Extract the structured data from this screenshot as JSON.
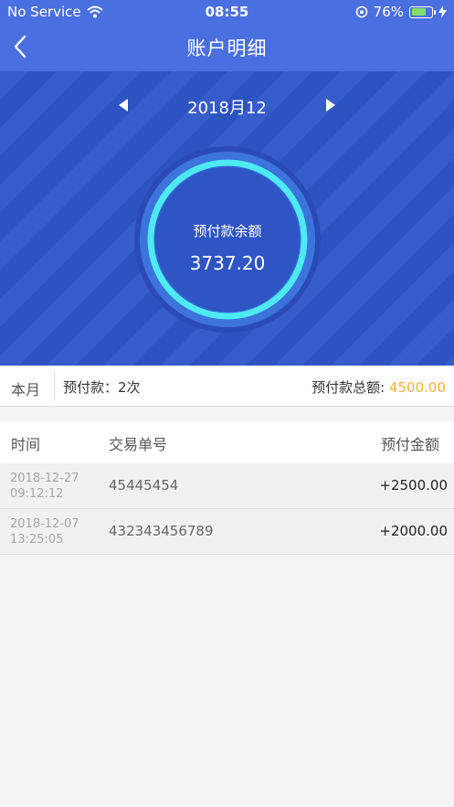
{
  "status_bar": {
    "carrier": "No Service",
    "time": "08:55",
    "battery_percent": "76%",
    "battery_level": 0.76
  },
  "nav": {
    "title": "账户明细",
    "back_icon": "chevron-left-icon"
  },
  "hero": {
    "month": "2018月12",
    "balance_label": "预付款余额",
    "balance_value": "3737.20"
  },
  "summary": {
    "month_label": "本月",
    "count_label": "预付款：2次",
    "total_label": "预付款总额:",
    "total_value": "4500.00"
  },
  "table": {
    "headers": [
      "时间",
      "交易单号",
      "预付金额"
    ],
    "rows": [
      {
        "date": "2018-12-27",
        "time": "09:12:12",
        "order": "45445454",
        "amount": "+2500.00"
      },
      {
        "date": "2018-12-07",
        "time": "13:25:05",
        "order": "432343456789",
        "amount": "+2000.00"
      }
    ]
  },
  "colors": {
    "header_blue": "#4a6fe0",
    "hero_blue": "#2e56c8",
    "ring_cyan": "#4ee9f3",
    "total_amount": "#f0b23c"
  }
}
